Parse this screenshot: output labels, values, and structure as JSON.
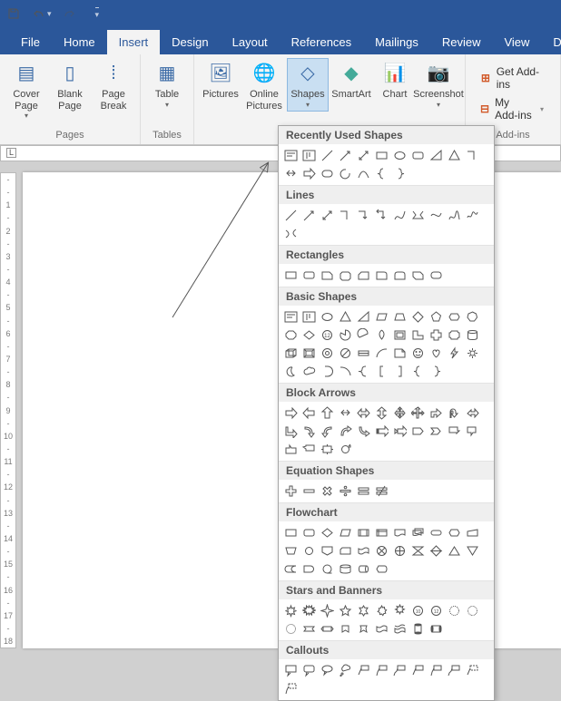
{
  "titlebar": {
    "l_label": "L"
  },
  "tabs": [
    "File",
    "Home",
    "Insert",
    "Design",
    "Layout",
    "References",
    "Mailings",
    "Review",
    "View",
    "Devel"
  ],
  "active_tab": 2,
  "ribbon": {
    "pages": {
      "label": "Pages",
      "cover": "Cover\nPage",
      "blank": "Blank\nPage",
      "pbreak": "Page\nBreak"
    },
    "tables": {
      "label": "Tables",
      "table": "Table"
    },
    "illus": {
      "pictures": "Pictures",
      "online_pics": "Online\nPictures",
      "shapes": "Shapes",
      "smartart": "SmartArt",
      "chart": "Chart",
      "screenshot": "Screenshot"
    },
    "addins": {
      "get": "Get Add-ins",
      "my": "My Add-ins",
      "label": "Add-ins"
    }
  },
  "ruler_v": [
    "-",
    "-",
    "1",
    "-",
    "2",
    "-",
    "3",
    "-",
    "4",
    "-",
    "5",
    "-",
    "6",
    "-",
    "7",
    "-",
    "8",
    "-",
    "9",
    "-",
    "10",
    "-",
    "11",
    "-",
    "12",
    "-",
    "13",
    "-",
    "14",
    "-",
    "15",
    "-",
    "16",
    "-",
    "17",
    "-",
    "18"
  ],
  "shape_menu": {
    "categories": [
      {
        "name": "Recently Used Shapes",
        "icons": [
          "textbox",
          "vtext",
          "line",
          "linearr",
          "linedbl",
          "rect",
          "oval",
          "rrect",
          "tri-r",
          "tri",
          "elbow",
          "darrow",
          "rarrow",
          "rrect2",
          "spiral",
          "curve",
          "lbrace",
          "rbrace"
        ]
      },
      {
        "name": "Lines",
        "icons": [
          "line",
          "linearr",
          "linedbl",
          "elbow",
          "elbowarr",
          "elbowd",
          "curve2",
          "zig",
          "curve3",
          "free",
          "scribble",
          "connector"
        ]
      },
      {
        "name": "Rectangles",
        "icons": [
          "rect",
          "rrect",
          "snip1",
          "snip2",
          "sniptl",
          "round1",
          "round2",
          "rdiag",
          "rbig"
        ]
      },
      {
        "name": "Basic Shapes",
        "icons": [
          "textbox",
          "vtext",
          "oval",
          "tri",
          "tri-r",
          "para",
          "trap",
          "diamond",
          "pent",
          "hex",
          "hept",
          "oct",
          "dec",
          "dodec",
          "pie",
          "chord",
          "tear",
          "frame",
          "lshape",
          "cross",
          "plaque",
          "can",
          "cube",
          "bevel",
          "donut",
          "noentry",
          "block",
          "arc",
          "fold",
          "smile",
          "heart",
          "bolt",
          "sun",
          "moon",
          "cloud",
          "rbrkt",
          "arc2",
          "lbrace2",
          "lbrkt",
          "rbrkt2",
          "lbrace",
          "rbrace"
        ]
      },
      {
        "name": "Block Arrows",
        "icons": [
          "rarrow",
          "larrow",
          "uarrow",
          "darrow",
          "lrarrow",
          "udarrow",
          "quad",
          "tri3",
          "bent",
          "uturn",
          "lup",
          "brtarr",
          "curR",
          "curL",
          "curU",
          "curD",
          "stripe",
          "notch",
          "pentR",
          "chevR",
          "rcallout",
          "dcallout",
          "ucallout",
          "lcallout",
          "quadc",
          "circ"
        ]
      },
      {
        "name": "Equation Shapes",
        "icons": [
          "plus",
          "minus",
          "mult",
          "div",
          "eq",
          "neq"
        ]
      },
      {
        "name": "Flowchart",
        "icons": [
          "proc",
          "alt",
          "dec",
          "data",
          "predef",
          "intern",
          "doc",
          "multi",
          "term",
          "prep",
          "manin",
          "manop",
          "conn",
          "offpage",
          "card",
          "tape",
          "sumj",
          "or",
          "collate",
          "sort",
          "extract",
          "merge",
          "stored",
          "delay",
          "seqstore",
          "magdisk",
          "direct",
          "display"
        ]
      },
      {
        "name": "Stars and Banners",
        "icons": [
          "exp1",
          "exp2",
          "star4",
          "star5",
          "star6",
          "star7",
          "star8",
          "star10",
          "star12",
          "star16",
          "star24",
          "star32",
          "ribbon2",
          "ribbon",
          "ribup",
          "ribup2",
          "wave",
          "dwave",
          "vscroll",
          "hscroll"
        ]
      },
      {
        "name": "Callouts",
        "icons": [
          "rect-co",
          "rrect-co",
          "oval-co",
          "cloud-co",
          "line1",
          "line2",
          "line3",
          "accent1",
          "accent2",
          "accent3",
          "border1",
          "border2"
        ]
      }
    ]
  }
}
